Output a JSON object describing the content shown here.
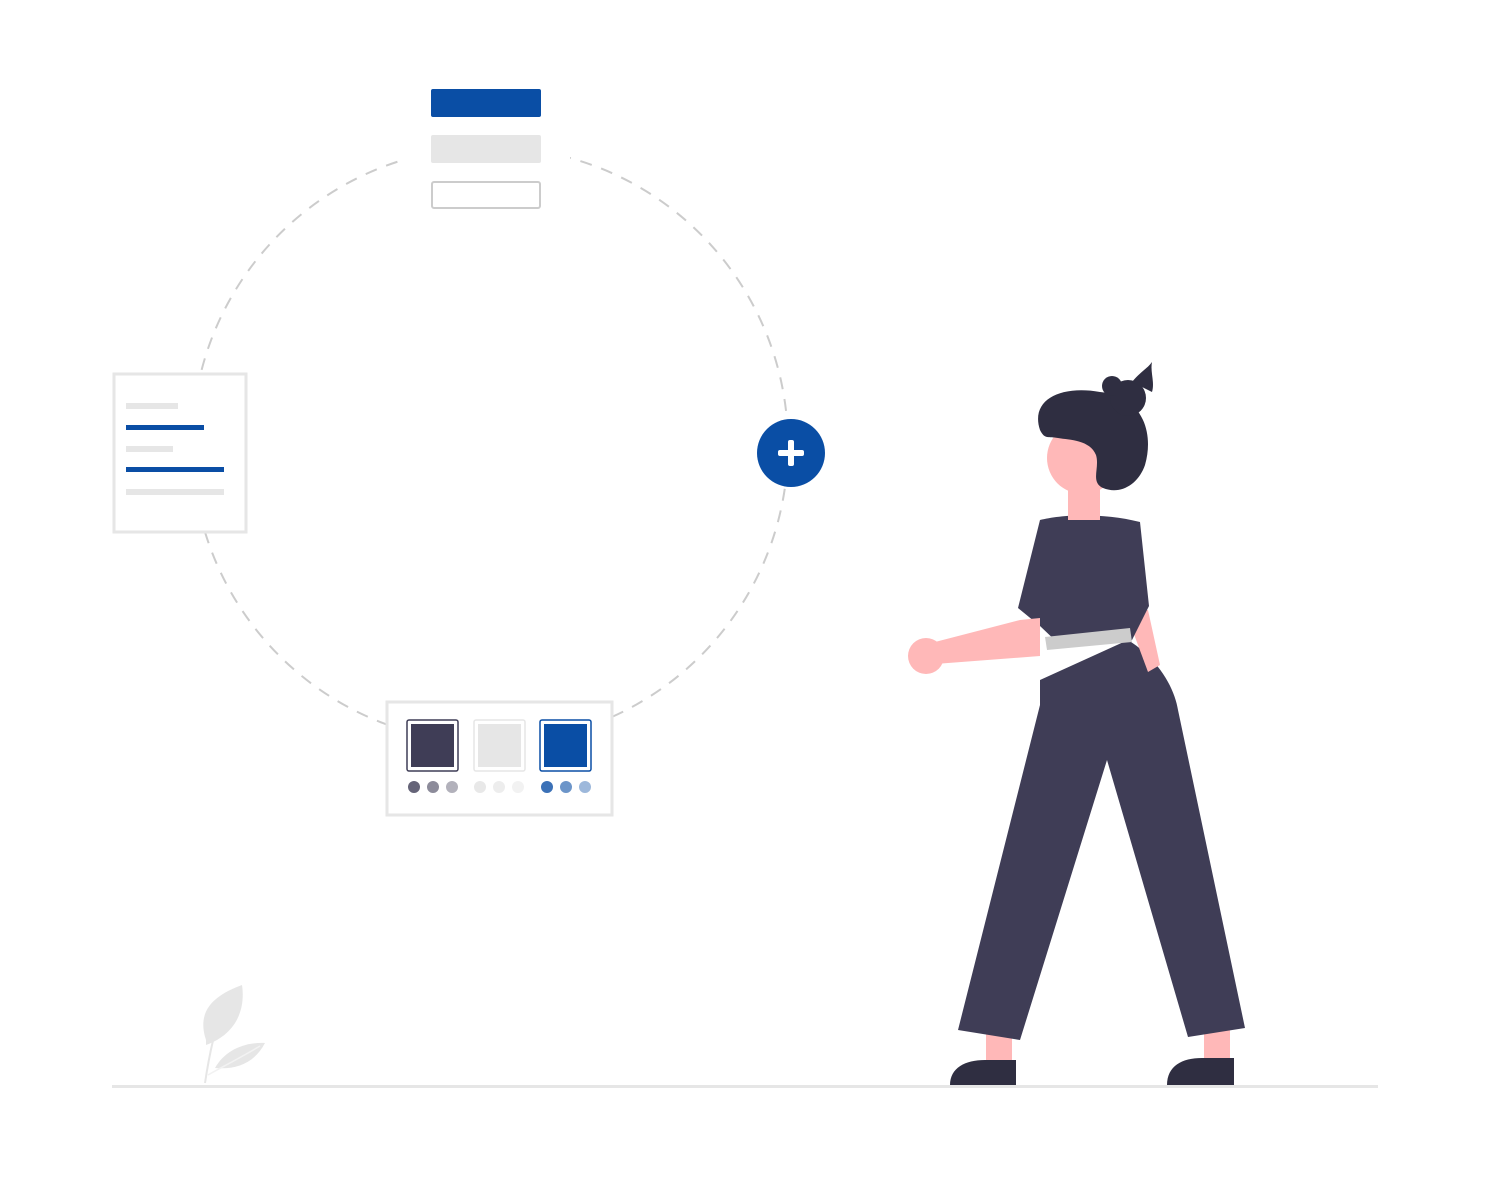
{
  "colors": {
    "accent": "#0a4ea5",
    "dark": "#3f3d56",
    "hair": "#2f2e41",
    "skin": "#ffb8b8",
    "light_gray": "#e6e6e6",
    "mid_gray": "#cccccc",
    "plant": "#e6e6e6"
  },
  "icons": {
    "add_button": "plus-icon"
  },
  "illustration": {
    "subject": "woman-standing-icon",
    "cycle_cards": [
      "button-styles-card",
      "text-lines-card",
      "color-palette-card"
    ]
  }
}
